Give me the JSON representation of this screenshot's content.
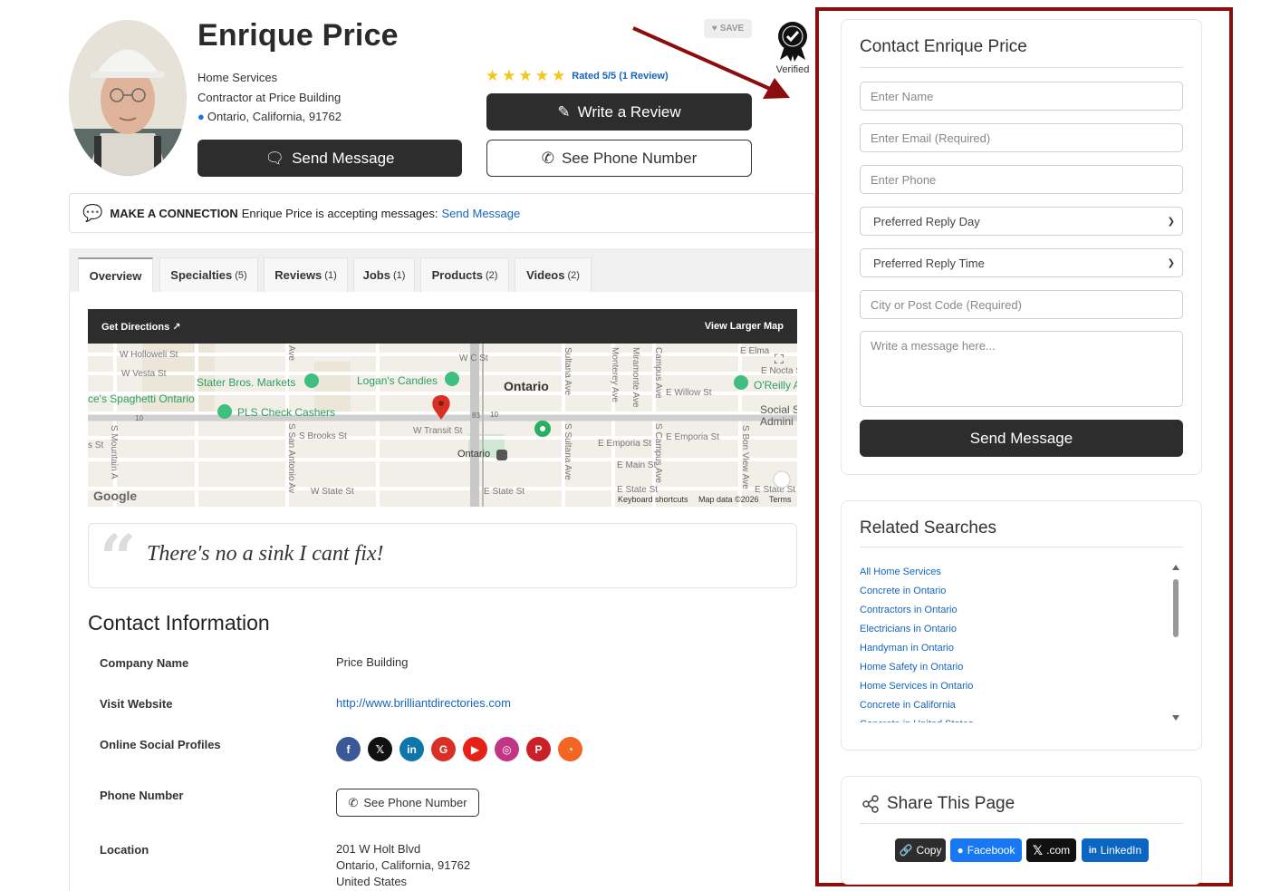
{
  "profile": {
    "name": "Enrique Price",
    "category": "Home Services",
    "title": "Contractor at Price Building",
    "location": "Ontario, California, 91762",
    "save_label": "SAVE",
    "verified_label": "Verified",
    "rating_text": "Rated 5/5 (1 Review)",
    "rating": 5,
    "rating_max": 5,
    "send_message_label": "Send Message",
    "write_review_label": "Write a Review",
    "see_phone_label": "See Phone Number"
  },
  "connection": {
    "heading": "MAKE A CONNECTION",
    "text": "Enrique Price is accepting messages:",
    "link": "Send Message"
  },
  "tabs": [
    {
      "label": "Overview",
      "count": ""
    },
    {
      "label": "Specialties",
      "count": "(5)"
    },
    {
      "label": "Reviews",
      "count": "(1)"
    },
    {
      "label": "Jobs",
      "count": "(1)"
    },
    {
      "label": "Products",
      "count": "(2)"
    },
    {
      "label": "Videos",
      "count": "(2)"
    }
  ],
  "map": {
    "directions_label": "Get Directions",
    "larger_map_label": "View Larger Map",
    "city": "Ontario",
    "streets": {
      "holloway": "W Holloweli St",
      "vesta": "W Vesta St",
      "brooks": "S Brooks St",
      "transit": "W Transit St",
      "emporia1": "E Emporia St",
      "emporia2": "E Emporia St",
      "main": "E Main St",
      "state1": "W State St",
      "state2": "E State St",
      "state3": "E State St",
      "state4": "E State St",
      "willow": "E Willow St",
      "elma": "E Elma",
      "nocta": "E Nocta St",
      "wc": "W C St",
      "mountain": "S Mountain A",
      "san_antonio": "S San Antonio Av",
      "ave1": "Ave",
      "sultana1": "Sultana Ave",
      "monterey": "Monterey Ave",
      "miramonte": "Miramonte Ave",
      "campus1": "Campus Ave",
      "campus2": "S Campus Ave",
      "sultana2": "S Sultana Ave",
      "bon_view": "S Bon View Ave",
      "left_st": "s St"
    },
    "pois": {
      "stater": "Stater Bros. Markets",
      "logans": "Logan's Candies",
      "spaghetti": "ce's Spaghetti Ontario",
      "pls": "PLS Check Cashers",
      "oreilly": "O'Reilly A",
      "social": "Social S",
      "admin": "Admini"
    },
    "station": "Ontario",
    "google": "Google",
    "shortcuts": "Keyboard shortcuts",
    "mapdata": "Map data ©2026",
    "terms": "Terms",
    "shield1": "83",
    "shield2": "10",
    "shield3": "10"
  },
  "quote": {
    "mark": "“",
    "text": "There's no a sink I cant fix!"
  },
  "contact_info": {
    "title": "Contact Information",
    "company_label": "Company Name",
    "company_value": "Price Building",
    "website_label": "Visit Website",
    "website_value": "http://www.brilliantdirectories.com",
    "social_label": "Online Social Profiles",
    "phone_label": "Phone Number",
    "phone_button": "See Phone Number",
    "location_label": "Location",
    "address_1": "201 W Holt Blvd",
    "address_2": "Ontario, California, 91762",
    "address_3": "United States"
  },
  "social_profiles": [
    {
      "name": "facebook-icon",
      "glyph": "f",
      "color": "#3b5998"
    },
    {
      "name": "x-icon",
      "glyph": "𝕏",
      "color": "#111111"
    },
    {
      "name": "linkedin-icon",
      "glyph": "in",
      "color": "#0e76a8"
    },
    {
      "name": "google-icon",
      "glyph": "G",
      "color": "#d93025"
    },
    {
      "name": "youtube-icon",
      "glyph": "▶",
      "color": "#e62117"
    },
    {
      "name": "instagram-icon",
      "glyph": "◎",
      "color": "#c13584"
    },
    {
      "name": "pinterest-icon",
      "glyph": "P",
      "color": "#cb2027"
    },
    {
      "name": "rss-icon",
      "glyph": "◔",
      "color": "#f26522"
    }
  ],
  "contact_form": {
    "title": "Contact Enrique Price",
    "name_placeholder": "Enter Name",
    "email_placeholder": "Enter Email (Required)",
    "phone_placeholder": "Enter Phone",
    "reply_day": "Preferred Reply Day",
    "reply_time": "Preferred Reply Time",
    "city_placeholder": "City or Post Code (Required)",
    "message_placeholder": "Write a message here...",
    "submit_label": "Send Message"
  },
  "related": {
    "title": "Related Searches",
    "items": [
      "All Home Services",
      "Concrete in Ontario",
      "Contractors in Ontario",
      "Electricians in Ontario",
      "Handyman in Ontario",
      "Home Safety in Ontario",
      "Home Services in Ontario",
      "Concrete in California",
      "Concrete in United States"
    ]
  },
  "share": {
    "title": "Share This Page",
    "copy": "Copy",
    "facebook": "Facebook",
    "x": ".com",
    "linkedin": "LinkedIn"
  },
  "colors": {
    "accent_dark": "#2d2d2d",
    "link": "#1565c0",
    "highlight_frame": "#8b0d0d",
    "star": "#f5c518"
  }
}
